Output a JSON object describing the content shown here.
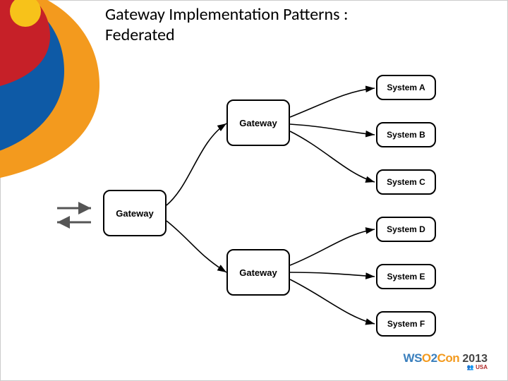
{
  "title": {
    "line1": "Gateway Implementation Patterns :",
    "line2": "Federated"
  },
  "nodes": {
    "gateway_main": "Gateway",
    "gateway_top": "Gateway",
    "gateway_bottom": "Gateway",
    "systems": {
      "a": "System A",
      "b": "System B",
      "c": "System C",
      "d": "System D",
      "e": "System E",
      "f": "System F"
    }
  },
  "footer": {
    "brand_left": "WS",
    "brand_o": "O",
    "brand_two": "2",
    "brand_con": "Con",
    "year": "2013",
    "region": "USA"
  },
  "chart_data": {
    "type": "diagram",
    "title": "Gateway Implementation Patterns : Federated",
    "nodes": [
      {
        "id": "external",
        "label": "(bidirectional external traffic)",
        "kind": "io"
      },
      {
        "id": "gw0",
        "label": "Gateway",
        "kind": "gateway",
        "tier": 1
      },
      {
        "id": "gw1",
        "label": "Gateway",
        "kind": "gateway",
        "tier": 2
      },
      {
        "id": "gw2",
        "label": "Gateway",
        "kind": "gateway",
        "tier": 2
      },
      {
        "id": "A",
        "label": "System A",
        "kind": "system"
      },
      {
        "id": "B",
        "label": "System B",
        "kind": "system"
      },
      {
        "id": "C",
        "label": "System C",
        "kind": "system"
      },
      {
        "id": "D",
        "label": "System D",
        "kind": "system"
      },
      {
        "id": "E",
        "label": "System E",
        "kind": "system"
      },
      {
        "id": "F",
        "label": "System F",
        "kind": "system"
      }
    ],
    "edges": [
      {
        "from": "external",
        "to": "gw0",
        "bidirectional": true
      },
      {
        "from": "gw0",
        "to": "gw1"
      },
      {
        "from": "gw0",
        "to": "gw2"
      },
      {
        "from": "gw1",
        "to": "A"
      },
      {
        "from": "gw1",
        "to": "B"
      },
      {
        "from": "gw1",
        "to": "C"
      },
      {
        "from": "gw2",
        "to": "D"
      },
      {
        "from": "gw2",
        "to": "E"
      },
      {
        "from": "gw2",
        "to": "F"
      }
    ]
  }
}
